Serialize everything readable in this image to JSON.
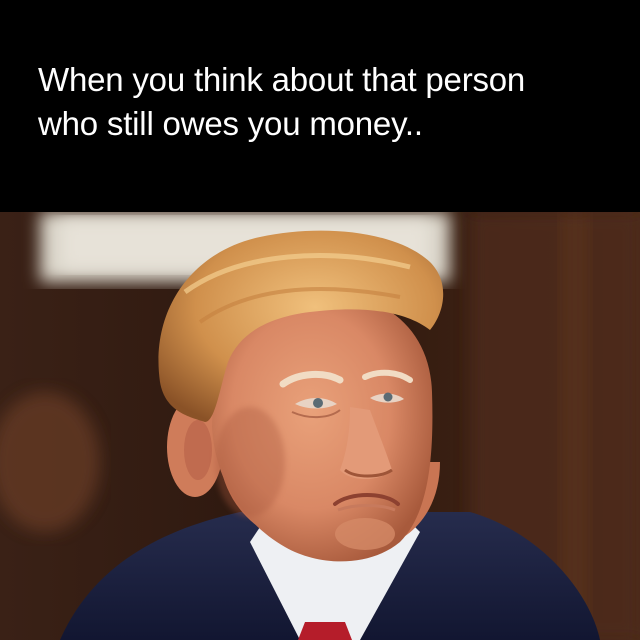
{
  "caption": {
    "line1": "When you think about that person",
    "line2": "who still owes you money.."
  },
  "photo": {
    "subject": "person-portrait",
    "colors": {
      "background_dark": "#2a160d",
      "background_wood": "#4a2a18",
      "wall_light": "#d9d4c8",
      "hair": "#d99a55",
      "skin": "#d98c6a",
      "suit": "#1d2340",
      "shirt": "#f2f2f4",
      "tie": "#b51d2a"
    }
  }
}
